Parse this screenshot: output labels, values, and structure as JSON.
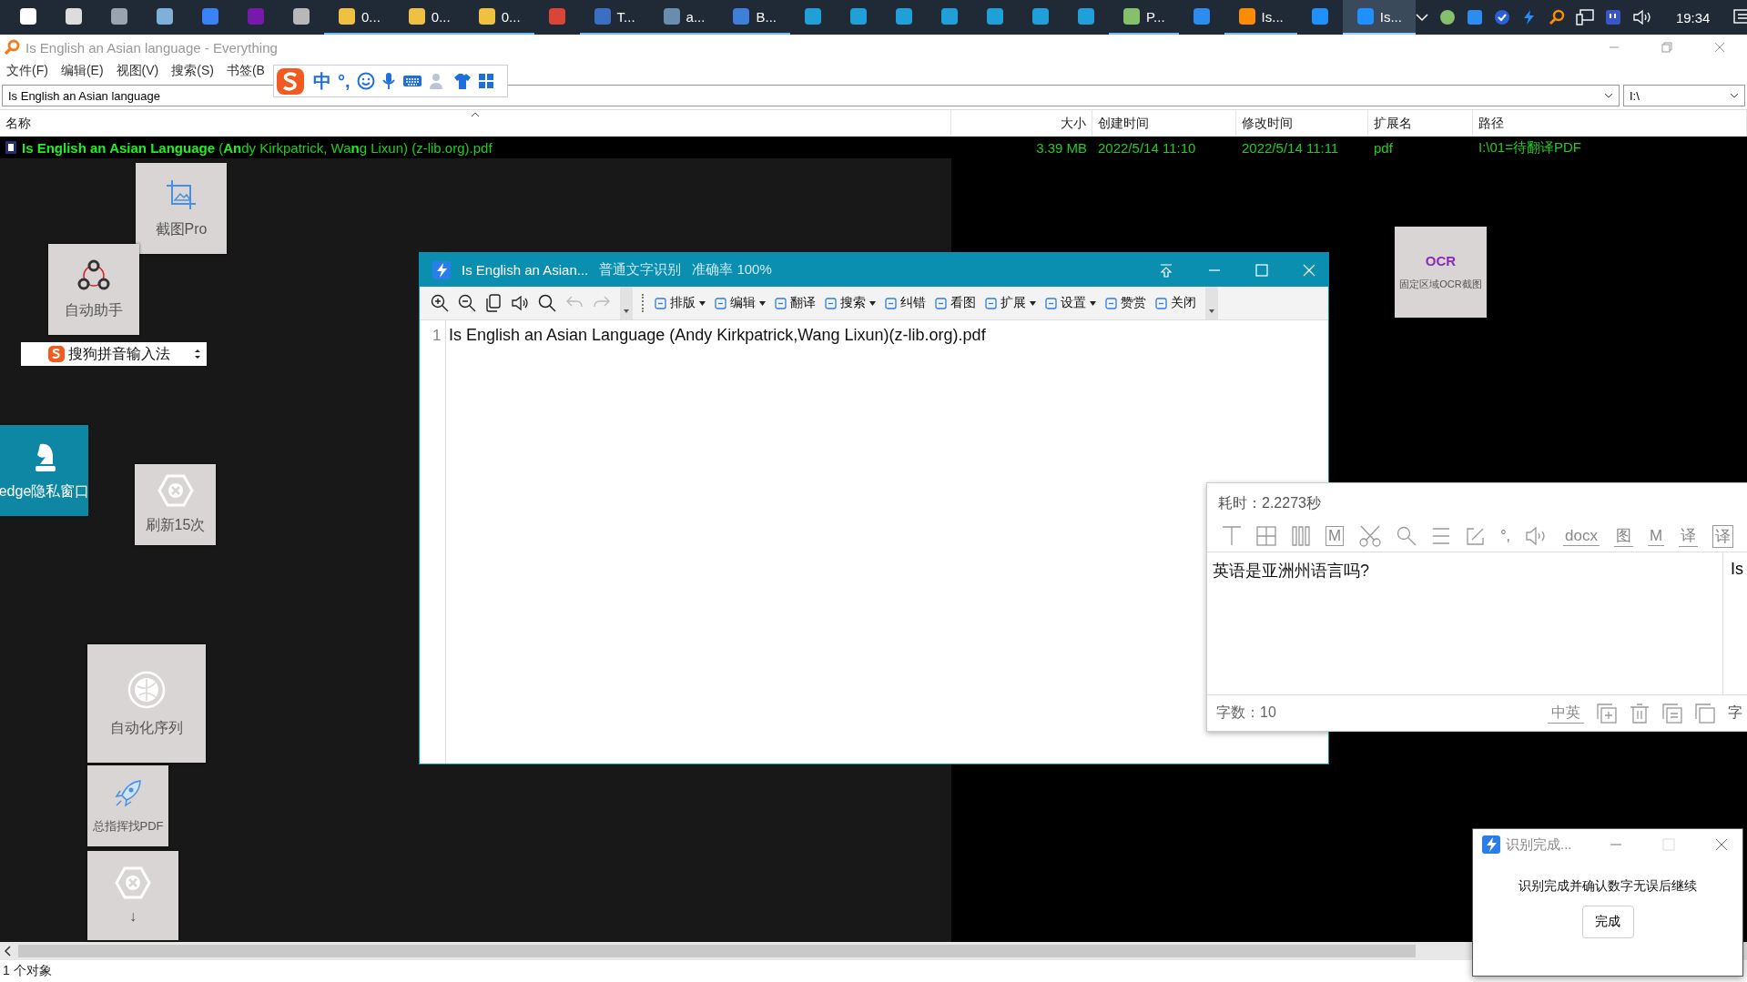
{
  "taskbar": {
    "items": [
      {
        "color": "#ffffff",
        "selected": false
      },
      {
        "color": "#dddddd",
        "selected": false
      },
      {
        "color": "#9aa4b0",
        "selected": false
      },
      {
        "color": "#7fb0d8",
        "selected": false
      },
      {
        "color": "#3b82f6",
        "selected": false
      },
      {
        "color": "#7719aa",
        "selected": false
      },
      {
        "color": "#b8b8b8",
        "selected": false
      },
      {
        "label": "0...",
        "color": "#f0c040",
        "selected": false
      },
      {
        "label": "0...",
        "color": "#f0c040",
        "selected": false
      },
      {
        "label": "0...",
        "color": "#f0c040",
        "selected": false
      },
      {
        "color": "#db4437",
        "selected": false
      },
      {
        "label": "T...",
        "color": "#3a6fc4",
        "selected": false
      },
      {
        "label": "a...",
        "color": "#6a8caf",
        "selected": false
      },
      {
        "label": "B...",
        "color": "#3f7fd8",
        "selected": false
      },
      {
        "color": "#1fa0d8",
        "selected": false
      },
      {
        "color": "#1fa0d8",
        "selected": false
      },
      {
        "color": "#1fa0d8",
        "selected": false
      },
      {
        "color": "#1fa0d8",
        "selected": false
      },
      {
        "color": "#1fa0d8",
        "selected": false
      },
      {
        "color": "#1fa0d8",
        "selected": false
      },
      {
        "color": "#1fa0d8",
        "selected": false
      },
      {
        "label": "P...",
        "color": "#86c06a",
        "selected": false
      },
      {
        "color": "#2d8cf0",
        "selected": false
      },
      {
        "label": "Is...",
        "color": "#ff8c00",
        "selected": false
      },
      {
        "color": "#1e90ff",
        "selected": false
      },
      {
        "label": "Is...",
        "color": "#1e90ff",
        "selected": true
      }
    ],
    "clock": "19:34"
  },
  "everything": {
    "title": "Is English an Asian language - Everything",
    "menu": [
      "文件(F)",
      "编辑(E)",
      "视图(V)",
      "搜索(S)",
      "书签(B"
    ],
    "search": {
      "value": "Is English an Asian language"
    },
    "drive": {
      "value": "I:\\"
    },
    "columns": [
      "名称",
      "大小",
      "创建时间",
      "修改时间",
      "扩展名",
      "路径"
    ],
    "rows": [
      {
        "name": "**Is English an Asian Language** (**An**dy Kirkpatrick, Wa**n**g Lixun) (z-lib.org).pdf",
        "size": "3.39 MB",
        "created": "2022/5/14 11:10",
        "modified": "2022/5/14 11:11",
        "ext": "pdf",
        "path": "I:\\01=待翻译PDF"
      }
    ],
    "status": "1 个对象"
  },
  "ime_toolbar": {
    "mode": "中",
    "punct": "°,"
  },
  "ime_bar": {
    "label": "搜狗拼音输入法"
  },
  "tiles": [
    {
      "label": "截图Pro",
      "kind": "crop",
      "color": "#d8d5d4"
    },
    {
      "label": "自动助手",
      "kind": "share",
      "color": "#d8d5d4"
    },
    {
      "label": "edge隐私窗口",
      "kind": "knight",
      "color": "#0e87a4"
    },
    {
      "label": "刷新15次",
      "kind": "hex",
      "color": "#d8d5d4"
    },
    {
      "label": "自动化序列",
      "kind": "globe",
      "color": "#d8d5d4"
    },
    {
      "label": "总指挥找PDF",
      "kind": "rocket",
      "color": "#d8d5d4"
    },
    {
      "label": "↓",
      "kind": "hex",
      "color": "#d8d5d4"
    },
    {
      "label": "固定区域OCR截图",
      "kind": "ocr",
      "badge": "OCR",
      "color": "#d8d5d4"
    }
  ],
  "ocr_window": {
    "title": "Is English an Asian...",
    "mode": "普通文字识别",
    "accuracy": "准确率 100%",
    "menus": [
      {
        "label": "排版",
        "dropdown": true
      },
      {
        "label": "编辑",
        "dropdown": true
      },
      {
        "label": "翻译",
        "dropdown": false
      },
      {
        "label": "搜索",
        "dropdown": true
      },
      {
        "label": "纠错",
        "dropdown": false
      },
      {
        "label": "看图",
        "dropdown": false
      },
      {
        "label": "扩展",
        "dropdown": true
      },
      {
        "label": "设置",
        "dropdown": true
      },
      {
        "label": "赞赏",
        "dropdown": false
      },
      {
        "label": "关闭",
        "dropdown": false
      }
    ],
    "lines": [
      {
        "number": "1",
        "text": "Is English an Asian Language (Andy Kirkpatrick,Wang Lixun)(z-lib.org).pdf"
      }
    ]
  },
  "result_panel": {
    "time": "耗时：2.2273秒",
    "tools": [
      {
        "kind": "top-align"
      },
      {
        "kind": "grid"
      },
      {
        "kind": "columns"
      },
      {
        "kind": "boxed",
        "label": "M"
      },
      {
        "kind": "scissors"
      },
      {
        "kind": "search"
      },
      {
        "kind": "lines"
      },
      {
        "kind": "edit"
      },
      {
        "kind": "plain",
        "label": "°,"
      },
      {
        "kind": "speaker"
      },
      {
        "kind": "underlined",
        "label": "docx"
      },
      {
        "kind": "underlined",
        "label": "图"
      },
      {
        "kind": "underlined",
        "label": "M"
      },
      {
        "kind": "underlined",
        "label": "译"
      },
      {
        "kind": "boxed",
        "label": "译"
      }
    ],
    "text": "英语是亚洲州语言吗?",
    "side_text": "Is",
    "count": "字数：10",
    "lang": "中英",
    "cut_label": "字"
  },
  "dialog": {
    "title": "识别完成...",
    "message": "识别完成并确认数字无误后继续",
    "button": "完成"
  }
}
